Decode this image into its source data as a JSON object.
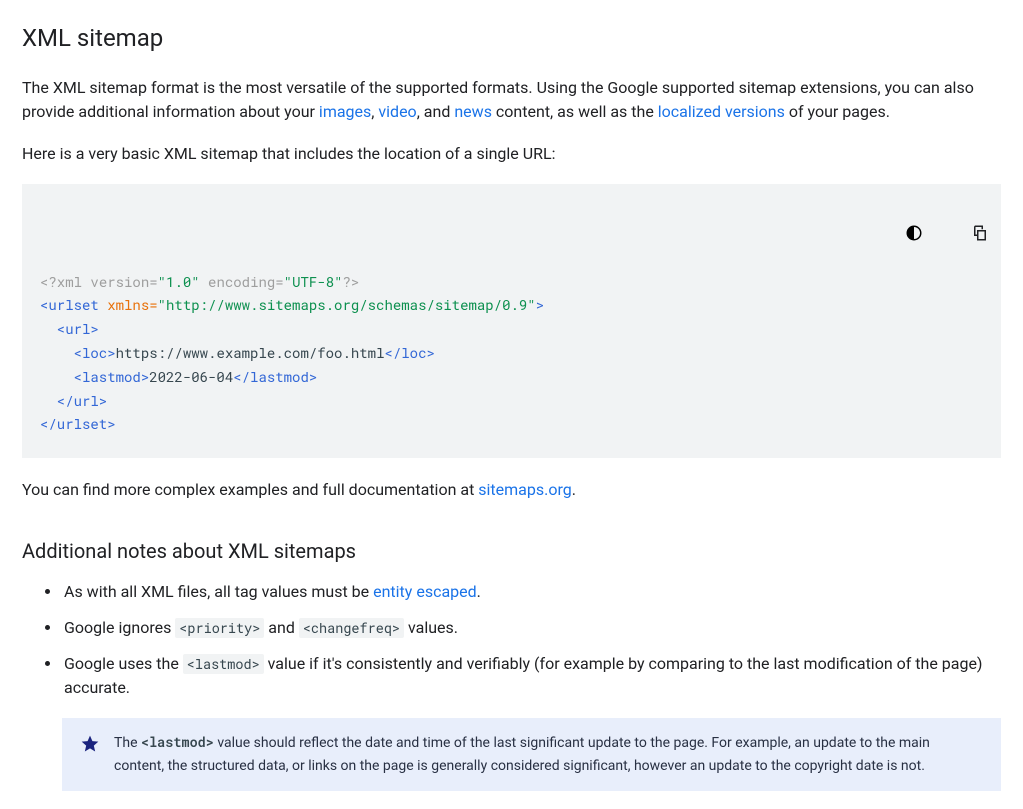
{
  "title": "XML sitemap",
  "intro": {
    "p1a": "The XML sitemap format is the most versatile of the supported formats. Using the Google supported sitemap extensions, you can also provide additional information about your ",
    "link_images": "images",
    "sep1": ", ",
    "link_video": "video",
    "sep2": ", and ",
    "link_news": "news",
    "p1b": " content, as well as the ",
    "link_localized": "localized versions",
    "p1c": " of your pages."
  },
  "p2": "Here is a very basic XML sitemap that includes the location of a single URL:",
  "code": {
    "xml_decl_open": "<?xml ",
    "xml_decl_version_attr": "version=",
    "xml_decl_version_val": "\"1.0\"",
    "xml_decl_encoding_attr": " encoding=",
    "xml_decl_encoding_val": "\"UTF-8\"",
    "xml_decl_close": "?>",
    "urlset_open": "<urlset",
    "urlset_attr": " xmlns=",
    "urlset_val": "\"http://www.sitemaps.org/schemas/sitemap/0.9\"",
    "urlset_open_end": ">",
    "url_open": "  <url>",
    "loc_open": "    <loc>",
    "loc_text": "https://www.example.com/foo.html",
    "loc_close": "</loc>",
    "lastmod_open": "    <lastmod>",
    "lastmod_text": "2022-06-04",
    "lastmod_close": "</lastmod>",
    "url_close": "  </url>",
    "urlset_close": "</urlset>"
  },
  "p3": {
    "a": "You can find more complex examples and full documentation at ",
    "link": "sitemaps.org",
    "b": "."
  },
  "subheading": "Additional notes about XML sitemaps",
  "notes": {
    "n1a": "As with all XML files, all tag values must be ",
    "n1_link": "entity escaped",
    "n1b": ".",
    "n2a": "Google ignores ",
    "n2_code1": "<priority>",
    "n2b": " and ",
    "n2_code2": "<changefreq>",
    "n2c": " values.",
    "n3a": "Google uses the ",
    "n3_code": "<lastmod>",
    "n3b": " value if it's consistently and verifiably (for example by comparing to the last modification of the page) accurate."
  },
  "callout": {
    "a": "The ",
    "code": "<lastmod>",
    "b": " value should reflect the date and time of the last significant update to the page. For example, an update to the main content, the structured data, or links on the page is generally considered significant, however an update to the copyright date is not."
  }
}
